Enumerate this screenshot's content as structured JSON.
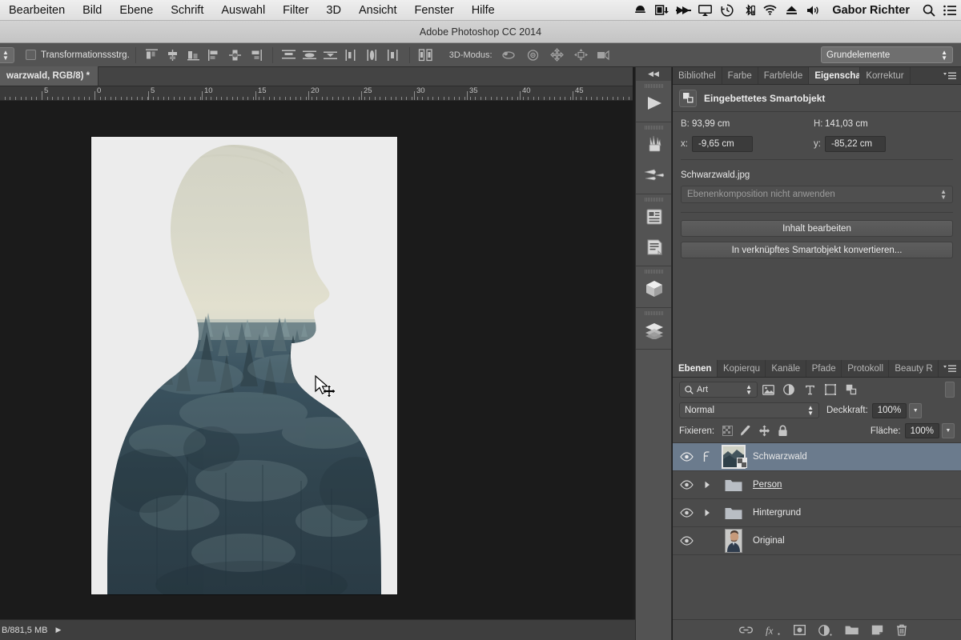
{
  "menubar": {
    "items": [
      "Bearbeiten",
      "Bild",
      "Ebene",
      "Schrift",
      "Auswahl",
      "Filter",
      "3D",
      "Ansicht",
      "Fenster",
      "Hilfe"
    ],
    "status_icons": [
      "dropbox-icon",
      "display-mirror-icon",
      "fast-forward-icon",
      "airplay-icon",
      "timemachine-icon",
      "bluetooth-icon",
      "wifi-icon",
      "eject-icon",
      "volume-icon"
    ],
    "user": "Gabor Richter",
    "search_icon": "search-icon",
    "notifications_icon": "list-icon"
  },
  "titlebar": {
    "title": "Adobe Photoshop CC 2014"
  },
  "options_bar": {
    "stepper_icon": "updown-stepper-icon",
    "checkbox_label": "Transformationssstrg.",
    "align_icons": [
      "align-left-edges-icon",
      "align-horizontal-centers-icon",
      "align-right-edges-icon",
      "align-top-edges-icon",
      "align-vertical-centers-icon",
      "align-bottom-edges-icon"
    ],
    "distribute_icons": [
      "distribute-top-edges-icon",
      "distribute-vertical-centers-icon",
      "distribute-bottom-edges-icon",
      "distribute-left-edges-icon",
      "distribute-horizontal-centers-icon",
      "distribute-right-edges-icon"
    ],
    "auto_distribute_icon": "auto-distribute-icon",
    "mode3d_label": "3D-Modus:",
    "mode3d_icons": [
      "rotate-3d-icon",
      "roll-3d-icon",
      "pan-3d-icon",
      "slide-3d-icon",
      "scale-3d-camera-icon"
    ],
    "workspace": "Grundelemente"
  },
  "document": {
    "tab_title": "warzwald, RGB/8) *",
    "ruler_labels": [
      "5",
      "0",
      "5",
      "10",
      "15",
      "20",
      "25",
      "30",
      "35",
      "40",
      "45"
    ],
    "ruler_positions": [
      52,
      118,
      185,
      252,
      319,
      385,
      451,
      517,
      583,
      649,
      715
    ]
  },
  "dock": {
    "collapse_icon": "collapse-panels-icon",
    "buttons": [
      {
        "name": "play-icon"
      },
      {
        "name": "brushes-icon"
      },
      {
        "name": "brush-presets-icon"
      },
      {
        "name": "character-styles-icon"
      },
      {
        "name": "paragraph-icon"
      },
      {
        "name": "3d-cube-icon"
      },
      {
        "name": "layers-stack-icon"
      }
    ]
  },
  "properties": {
    "tabs": [
      {
        "label": "Bibliothel",
        "active": false
      },
      {
        "label": "Farbe",
        "active": false
      },
      {
        "label": "Farbfelde",
        "active": false
      },
      {
        "label": "Eigenschaften",
        "active": true
      },
      {
        "label": "Korrektur",
        "active": false
      }
    ],
    "menu_icon": "panel-menu-icon",
    "header_icon": "smart-object-icon",
    "header_title": "Eingebettetes Smartobjekt",
    "width_label": "B:",
    "width_value": "93,99 cm",
    "height_label": "H:",
    "height_value": "141,03 cm",
    "x_label": "x:",
    "x_value": "-9,65 cm",
    "y_label": "y:",
    "y_value": "-85,22 cm",
    "filename": "Schwarzwald.jpg",
    "comp_select": "Ebenenkomposition nicht anwenden",
    "edit_content_button": "Inhalt bearbeiten",
    "convert_button": "In verknüpftes Smartobjekt konvertieren..."
  },
  "layers": {
    "tabs": [
      {
        "label": "Ebenen",
        "active": true
      },
      {
        "label": "Kopierqu",
        "active": false
      },
      {
        "label": "Kanäle",
        "active": false
      },
      {
        "label": "Pfade",
        "active": false
      },
      {
        "label": "Protokoll",
        "active": false
      },
      {
        "label": "Beauty R",
        "active": false
      }
    ],
    "menu_icon": "panel-menu-icon",
    "filter_kind": "Art",
    "filter_search_icon": "search-icon",
    "filter_icons": [
      "filter-pixel-icon",
      "filter-adjustment-icon",
      "filter-type-icon",
      "filter-shape-icon",
      "filter-smartobject-icon"
    ],
    "filter_toggle_icon": "filter-toggle-icon",
    "blend_mode": "Normal",
    "opacity_label": "Deckkraft:",
    "opacity_value": "100%",
    "lock_label": "Fixieren:",
    "lock_icons": [
      "lock-transparency-icon",
      "lock-image-icon",
      "lock-position-icon",
      "lock-all-icon"
    ],
    "fill_label": "Fläche:",
    "fill_value": "100%",
    "rows": [
      {
        "name": "Schwarzwald",
        "type": "smartobject",
        "selected": true,
        "visible": true,
        "underline": false,
        "has_link_icon": true
      },
      {
        "name": "Person",
        "type": "group",
        "selected": false,
        "visible": true,
        "underline": true,
        "expanded": false
      },
      {
        "name": "Hintergrund",
        "type": "group",
        "selected": false,
        "visible": true,
        "underline": false,
        "expanded": false
      },
      {
        "name": "Original",
        "type": "image",
        "selected": false,
        "visible": true,
        "underline": false
      }
    ],
    "footer_icons": [
      "link-layers-icon",
      "fx-icon",
      "add-mask-icon",
      "adjustment-layer-icon",
      "new-group-icon",
      "new-layer-icon",
      "delete-layer-icon"
    ]
  },
  "statusbar": {
    "text": "B/881,5 MB",
    "arrow_icon": "status-expand-icon"
  },
  "colors": {
    "panel_bg": "#4b4b4b",
    "options_bg": "#535353",
    "canvas_bg": "#1b1b1b",
    "selection_blue": "#6b7b8d",
    "artboard_bg": "#ececec"
  }
}
